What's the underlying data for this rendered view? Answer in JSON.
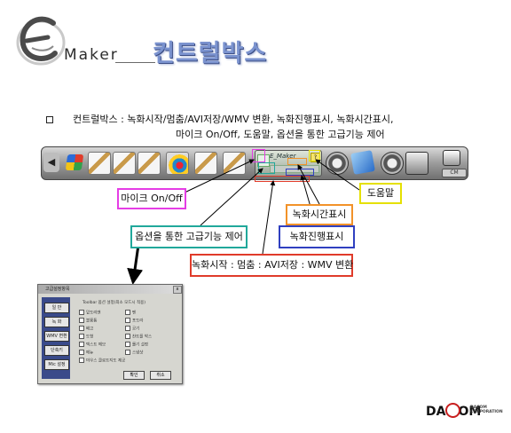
{
  "header": {
    "logo_text": "Maker",
    "title": "컨트럴박스"
  },
  "description": {
    "line1": "컨트럴박스 : 녹화시작/멈춤/AVI저장/WMV 변환, 녹화진행표시, 녹화시간표시,",
    "line2": "마이크 On/Off, 도움말, 옵션을 통한 고급기능 제어"
  },
  "toolbar": {
    "panel_logo": "E_Maker",
    "help_glyph": "?",
    "cm_button": "CM"
  },
  "callouts": {
    "mic": "마이크 On/Off",
    "help": "도움말",
    "time": "녹화시간표시",
    "options": "옵션을 통한 고급기능 제어",
    "progress": "녹화진행표시",
    "record": "녹화시작 : 멈춤 : AVI저장 : WMV 변환"
  },
  "colors": {
    "mic": "#e53de5",
    "help": "#e5e000",
    "time": "#f29229",
    "options": "#21a89b",
    "progress": "#3040c0",
    "record": "#e03b2a"
  },
  "dialog": {
    "title": "고급설정항목",
    "close": "x",
    "sidebar": [
      "일 반",
      "녹 화",
      "WMV 변환",
      "단축키",
      "Mic 설정"
    ],
    "heading": "Toolbar 옵션 설정(최소 모드시 적용)",
    "left_items": [
      "밑도리앤",
      "볼륨통",
      "배고",
      "도형",
      "텍스트 메모",
      "메뉴",
      "마우스 클로트지도 제공"
    ],
    "right_items": [
      "펜",
      "포도라",
      "공기",
      "찬트를 박스",
      "롤기 설정",
      "스냅샷"
    ],
    "ok": "확인",
    "cancel": "취소"
  },
  "footer": {
    "brand_left": "DA",
    "brand_right": "OM",
    "brand_sub1": "DACOM",
    "brand_sub2": "CORPORATION"
  }
}
